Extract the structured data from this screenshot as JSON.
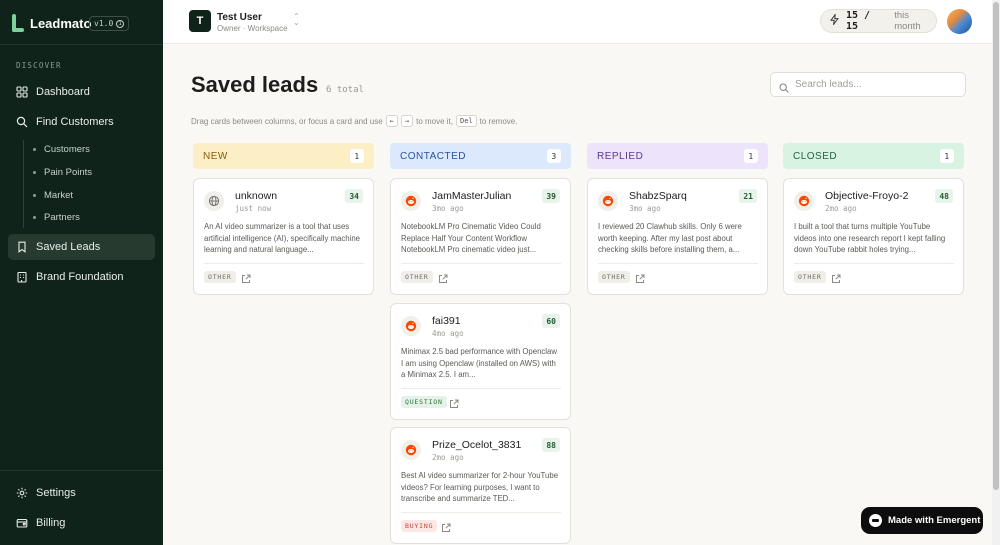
{
  "brand": {
    "name": "Leadmato",
    "version": "v1.0"
  },
  "sidebar": {
    "section_label": "DISCOVER",
    "items": [
      {
        "label": "Dashboard",
        "icon": "grid-icon"
      },
      {
        "label": "Find Customers",
        "icon": "search-icon"
      },
      {
        "label": "Saved Leads",
        "icon": "bookmark-icon",
        "active": true
      },
      {
        "label": "Brand Foundation",
        "icon": "building-icon"
      }
    ],
    "sub_items": [
      "Customers",
      "Pain Points",
      "Market",
      "Partners"
    ],
    "bottom_items": [
      {
        "label": "Settings",
        "icon": "gear-icon"
      },
      {
        "label": "Billing",
        "icon": "wallet-icon"
      }
    ]
  },
  "header": {
    "workspace_initial": "T",
    "user_name": "Test User",
    "user_role": "Owner · Workspace",
    "credits_count": "15 / 15",
    "credits_period": "this month"
  },
  "main": {
    "title": "Saved leads",
    "count": "6 total",
    "search_placeholder": "Search leads...",
    "hint": {
      "part1": "Drag cards between columns, or focus a card and use",
      "key_left": "←",
      "key_right": "→",
      "part2": "to move it,",
      "key_del": "Del",
      "part3": "to remove."
    }
  },
  "columns": [
    {
      "name": "NEW",
      "count": "1",
      "bg": "#fcefc6",
      "color": "#8a5a0a"
    },
    {
      "name": "CONTACTED",
      "count": "3",
      "bg": "#dce8fb",
      "color": "#2a5397"
    },
    {
      "name": "REPLIED",
      "count": "1",
      "bg": "#ede3fb",
      "color": "#5b3a8f"
    },
    {
      "name": "CLOSED",
      "count": "1",
      "bg": "#d9f3e2",
      "color": "#256240"
    }
  ],
  "cards": [
    {
      "name": "unknown",
      "time": "just now",
      "score": "34",
      "source": "globe-icon",
      "tag": "OTHER",
      "excerpt": "An AI video summarizer is a tool that uses artificial intelligence (AI), specifically machine learning and natural language..."
    },
    {
      "name": "JamMasterJulian",
      "time": "3mo ago",
      "score": "39",
      "source": "reddit-icon",
      "tag": "OTHER",
      "excerpt": "NotebookLM Pro Cinematic Video Could Replace Half Your Content Workflow NotebookLM Pro cinematic video just..."
    },
    {
      "name": "fai391",
      "time": "4mo ago",
      "score": "60",
      "source": "reddit-icon",
      "tag": "QUESTION",
      "excerpt": "Minimax 2.5 bad performance with Openclaw I am using Openclaw (installed on AWS) with a Minimax 2.5. I am..."
    },
    {
      "name": "Prize_Ocelot_3831",
      "time": "2mo ago",
      "score": "88",
      "source": "reddit-icon",
      "tag": "BUYING",
      "excerpt": "Best AI video summarizer for 2-hour YouTube videos? For learning purposes, I want to transcribe and summarize TED..."
    },
    {
      "name": "ShabzSparq",
      "time": "3mo ago",
      "score": "21",
      "source": "reddit-icon",
      "tag": "OTHER",
      "excerpt": "I reviewed 20 Clawhub skills. Only 6 were worth keeping. After my last post about checking skills before installing them, a..."
    },
    {
      "name": "Objective-Froyo-2",
      "time": "2mo ago",
      "score": "48",
      "source": "reddit-icon",
      "tag": "OTHER",
      "excerpt": "I built a tool that turns multiple YouTube videos into one research report I kept falling down YouTube rabbit holes trying..."
    }
  ],
  "emergent": {
    "label": "Made with Emergent"
  }
}
